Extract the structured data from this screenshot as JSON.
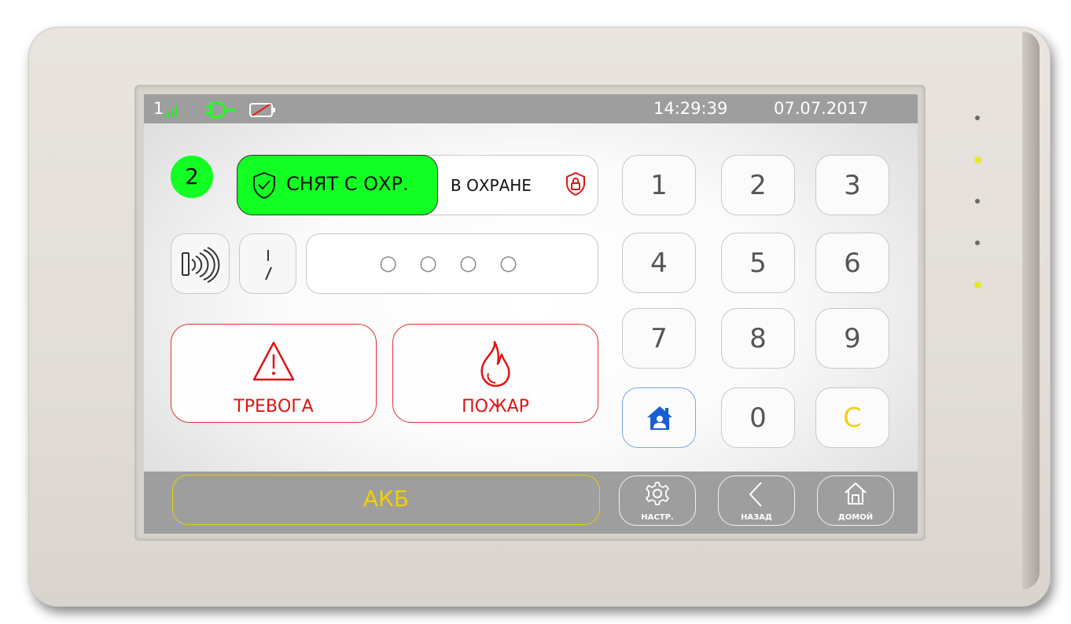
{
  "status": {
    "sim_number": "1",
    "time": "14:29:39",
    "date": "07.07.2017"
  },
  "partition": {
    "number": "2"
  },
  "mode": {
    "disarmed_label": "СНЯТ С ОХР.",
    "armed_label": "В ОХРАНЕ"
  },
  "code_field": {
    "value": "○ ○ ○ ○"
  },
  "actions": {
    "alarm_label": "ТРЕВОГА",
    "fire_label": "ПОЖАР"
  },
  "keypad": {
    "keys": [
      "1",
      "2",
      "3",
      "4",
      "5",
      "6",
      "7",
      "8",
      "9",
      "0",
      "C"
    ]
  },
  "navbar": {
    "battery_label": "АКБ",
    "settings_label": "НАСТР.",
    "back_label": "НАЗАД",
    "home_label": "ДОМОЙ"
  },
  "colors": {
    "green_active": "#11ff22",
    "alarm_red": "#e01414",
    "akb_yellow": "#f0d000",
    "home_blue": "#1a5fd6",
    "led_yellow": "#e8ee00"
  },
  "icons": [
    "signal-icon",
    "power-plug-icon",
    "battery-empty-icon",
    "shield-check-icon",
    "lock-icon",
    "rfid-icon",
    "switch-icon",
    "warning-icon",
    "fire-icon",
    "home-person-icon",
    "gear-icon",
    "chevron-left-icon",
    "house-icon"
  ]
}
